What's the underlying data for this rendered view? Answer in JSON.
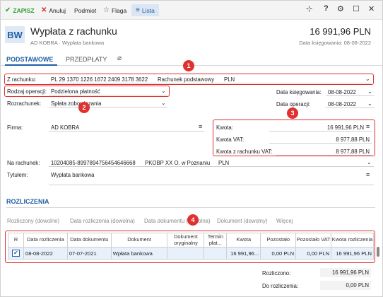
{
  "toolbar": {
    "save": "ZAPISZ",
    "cancel": "Anuluj",
    "subject": "Podmiot",
    "flag": "Flaga",
    "list": "Lista"
  },
  "header": {
    "logo": "BW",
    "title": "Wypłata z rachunku",
    "subtitle": "AD KOBRA  ·  Wypłata bankowa",
    "amount": "16 991,96 PLN",
    "booking_date": "Data księgowania: 08-08-2022"
  },
  "tabs": [
    "PODSTAWOWE",
    "PRZEDPŁATY"
  ],
  "form": {
    "from_account_label": "Z rachunku:",
    "from_account_number": "PL 29 1370 1226 1672 2409 3178 3622",
    "from_account_name": "Rachunek podstawowy",
    "from_account_currency": "PLN",
    "operation_type_label": "Rodzaj operacji:",
    "operation_type_value": "Podzielona płatność",
    "settlement_label": "Rozrachunek:",
    "settlement_value": "Spłata zobowiązania",
    "booking_date_label": "Data księgowania:",
    "booking_date_value": "08-08-2022",
    "operation_date_label": "Data operacji:",
    "operation_date_value": "08-08-2022",
    "company_label": "Firma:",
    "company_value": "AD KOBRA",
    "amount_label": "Kwota:",
    "amount_value": "16 991,96 PLN",
    "vat_label": "Kwota VAT:",
    "vat_value": "8 977,88 PLN",
    "vat_account_label": "Kwota z rachunku VAT:",
    "vat_account_value": "8 977,88 PLN",
    "to_account_label": "Na rachunek:",
    "to_account_number": "10204085-8997894756454646668",
    "to_account_bank": "PKOBP XX O. w Poznaniu",
    "to_account_currency": "PLN",
    "title_label": "Tytułem:",
    "title_value": "Wypłata bankowa"
  },
  "settlements": {
    "section_title": "ROZLICZENIA",
    "links": [
      "Rozliczony (dowolne)",
      "Data rozliczenia (dowolna)",
      "Data dokumentu (dowolna)",
      "Dokument (dowolny)",
      "Więcej"
    ],
    "columns": [
      "R",
      "Data rozliczenia",
      "Data dokumentu",
      "Dokument",
      "Dokument oryginalny",
      "Termin płat...",
      "Kwota",
      "Pozostało",
      "Pozostało VAT",
      "Kwota rozliczenia"
    ],
    "rows": [
      {
        "checked": "✔",
        "settle_date": "08-08-2022",
        "doc_date": "07-07-2021",
        "document": "Wpłata bankowa",
        "original": "",
        "term": "",
        "amount": "16 991,96...",
        "remaining": "0,00 PLN",
        "remaining_vat": "0,00 PLN",
        "settle_amount": "16 991,96 PLN"
      }
    ],
    "settled_label": "Rozliczono:",
    "settled_value": "16 991,96 PLN",
    "to_settle_label": "Do rozliczenia:",
    "to_settle_value": "0,00 PLN"
  },
  "callouts": [
    "1",
    "2",
    "3",
    "4"
  ],
  "colors": {
    "accent": "#1f5fa6",
    "highlight": "#e03030",
    "save": "#2e9e2e",
    "cancel": "#d0312d"
  }
}
